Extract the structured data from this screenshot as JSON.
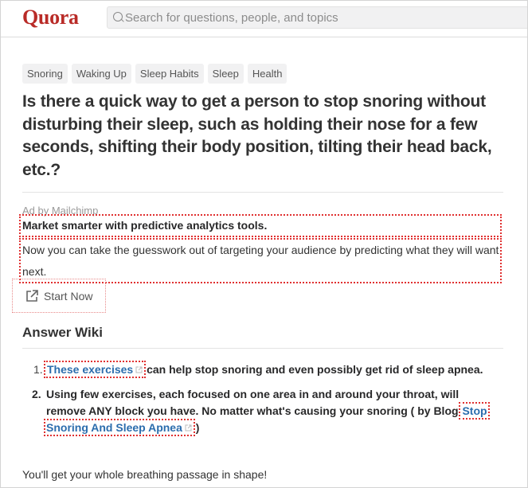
{
  "header": {
    "logo": "Quora",
    "search_placeholder": "Search for questions, people, and topics"
  },
  "topics": [
    "Snoring",
    "Waking Up",
    "Sleep Habits",
    "Sleep",
    "Health"
  ],
  "question": {
    "title": "Is there a quick way to get a person to stop snoring without disturbing their sleep, such as holding their nose for a few seconds, shifting their body position, tilting their head back, etc.?"
  },
  "ad": {
    "sponsor": "Ad by Mailchimp",
    "title": "Market smarter with predictive analytics tools.",
    "body": "Now you can take the guesswork out of targeting your audience by predicting what they will want next.",
    "cta_label": "Start Now",
    "cta_icon": "external-link-icon"
  },
  "answer_wiki": {
    "heading": "Answer Wiki",
    "items": [
      {
        "number": "1.",
        "link_text": "These exercises",
        "text_after": " can help stop snoring and even possibly get rid of sleep apnea."
      },
      {
        "number": "2.",
        "text_before": "Using few exercises, each focused on one area in and around your throat, will remove ANY block you have. No matter what's causing your snoring ( by Blog ",
        "link_text": "Stop Snoring And Sleep Apnea",
        "text_after": " )"
      }
    ],
    "footer_text": "You'll get your whole breathing passage in shape!"
  },
  "colors": {
    "brand": "#b92b27",
    "link": "#2b6dad",
    "highlight_outline": "#e03030"
  }
}
